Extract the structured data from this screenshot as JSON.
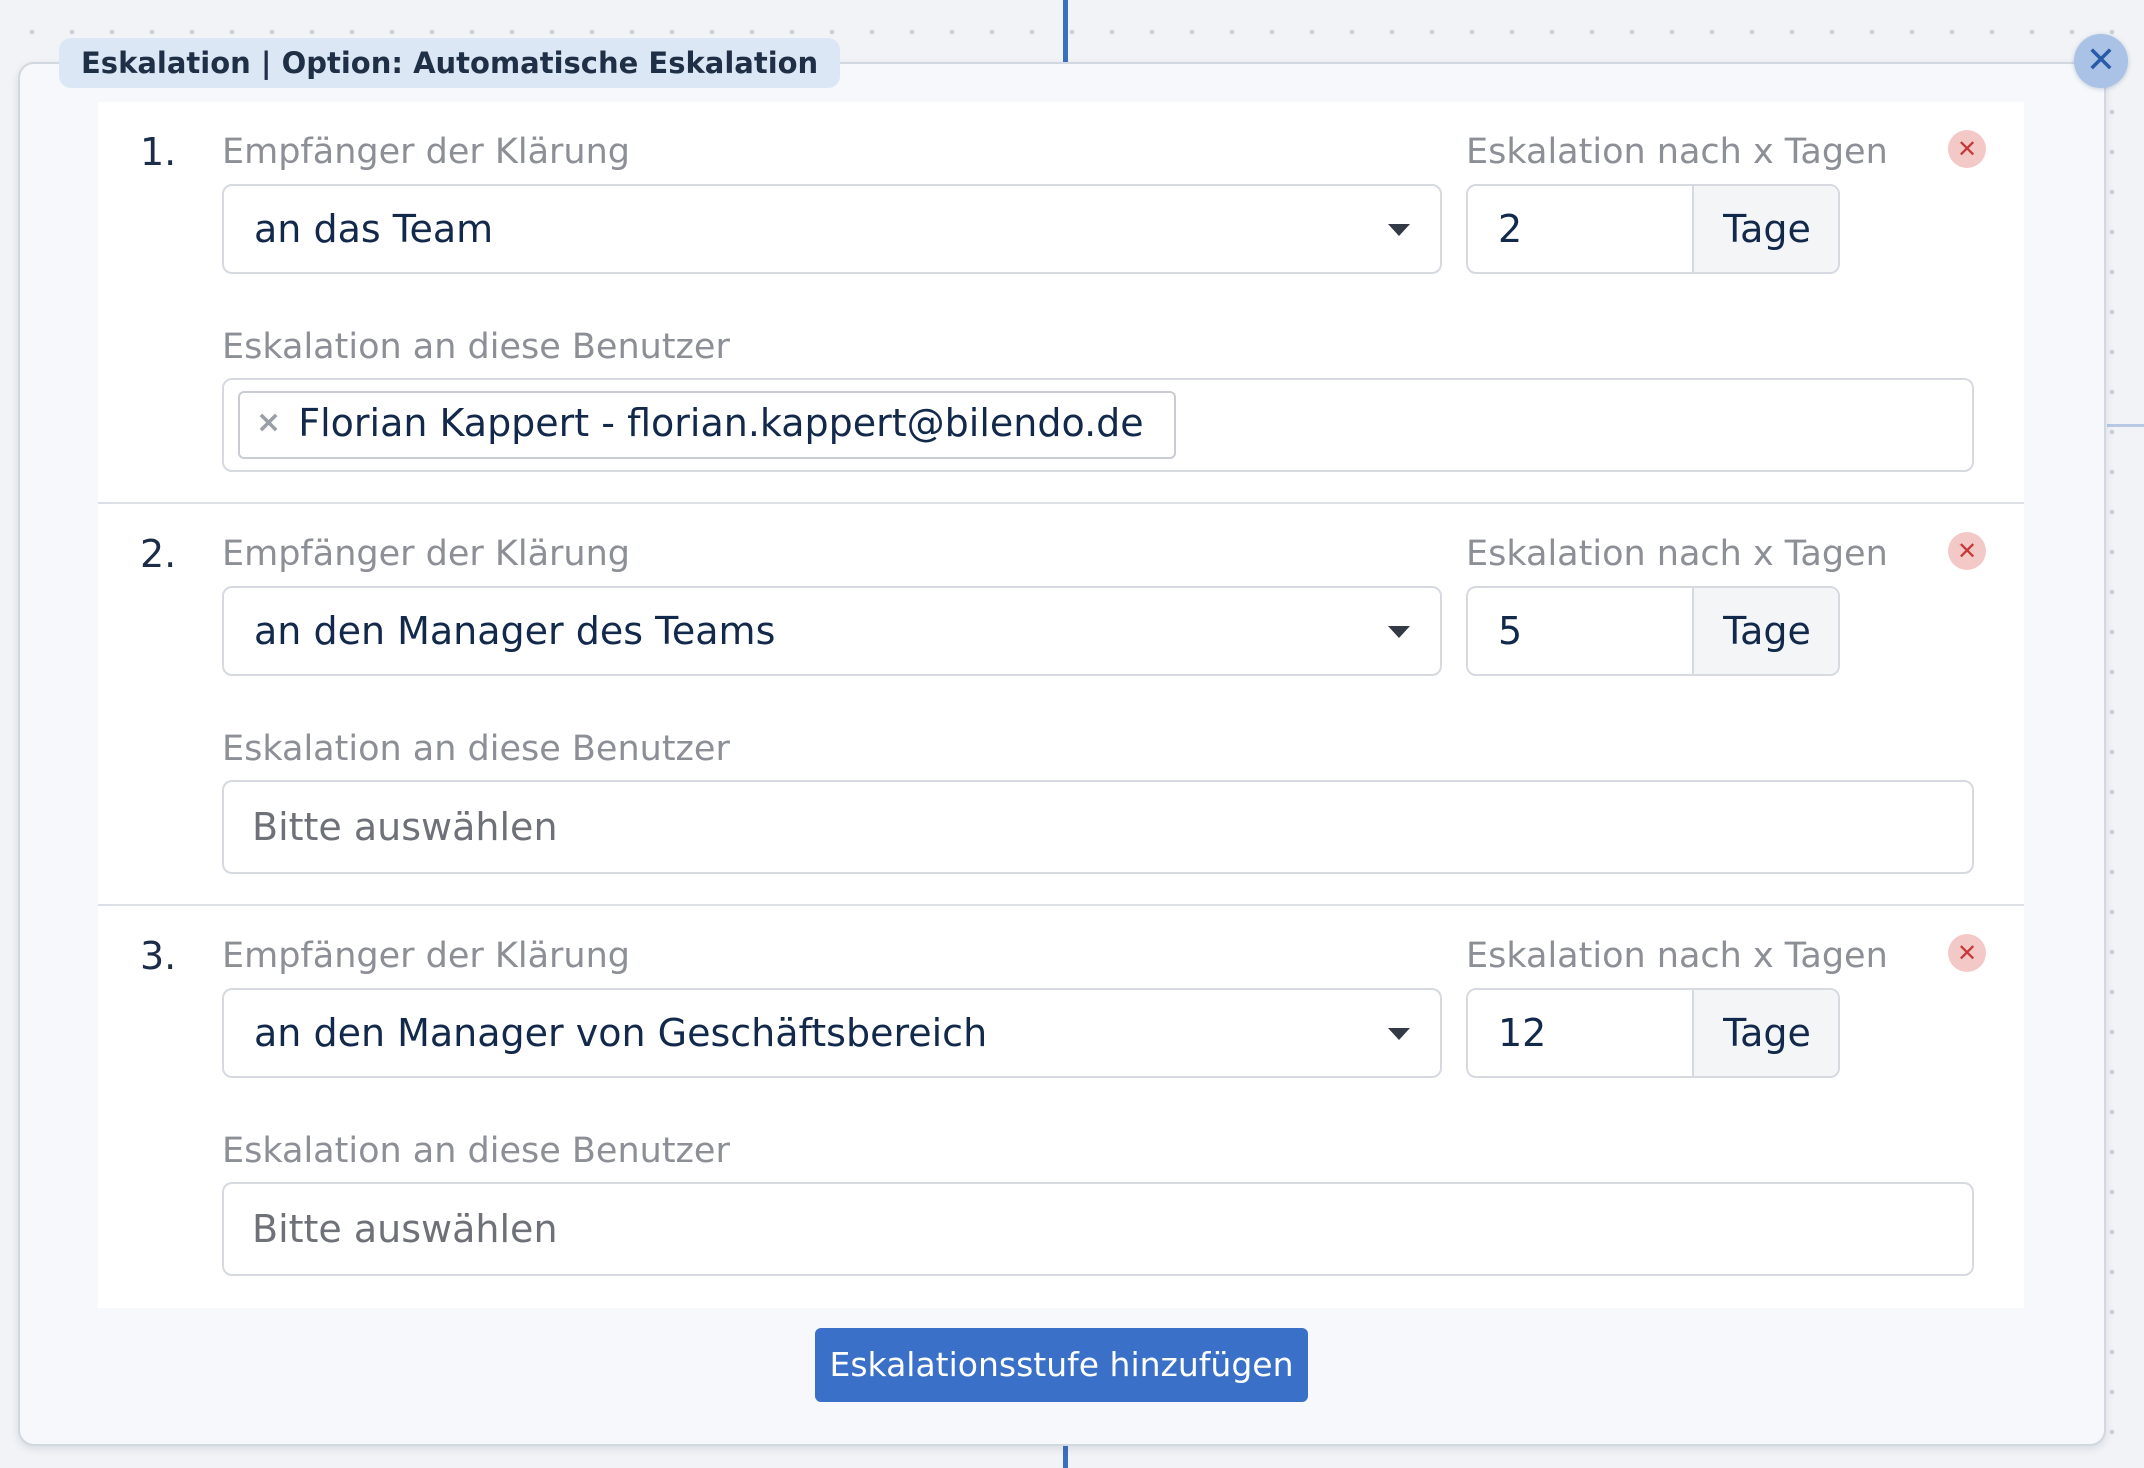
{
  "panel": {
    "title": "Eskalation | Option: Automatische Eskalation",
    "close_icon": "close-icon"
  },
  "labels": {
    "recipient": "Empfänger der Klärung",
    "days": "Eskalation nach x Tagen",
    "users": "Eskalation an diese Benutzer"
  },
  "steps": [
    {
      "number": "1.",
      "recipient": "an das Team",
      "days": "2",
      "unit": "Tage",
      "users": [
        "Florian Kappert - florian.kappert@bilendo.de"
      ]
    },
    {
      "number": "2.",
      "recipient": "an den Manager des Teams",
      "days": "5",
      "unit": "Tage",
      "users_placeholder": "Bitte auswählen"
    },
    {
      "number": "3.",
      "recipient": "an den Manager von Geschäftsbereich",
      "days": "12",
      "unit": "Tage",
      "users_placeholder": "Bitte auswählen"
    }
  ],
  "add_button_label": "Eskalationsstufe hinzufügen",
  "colors": {
    "accent": "#3a70c8",
    "connector": "#3a6fbd",
    "remove": "#c5393a",
    "text": "#13294b",
    "label": "#8c8f95"
  }
}
